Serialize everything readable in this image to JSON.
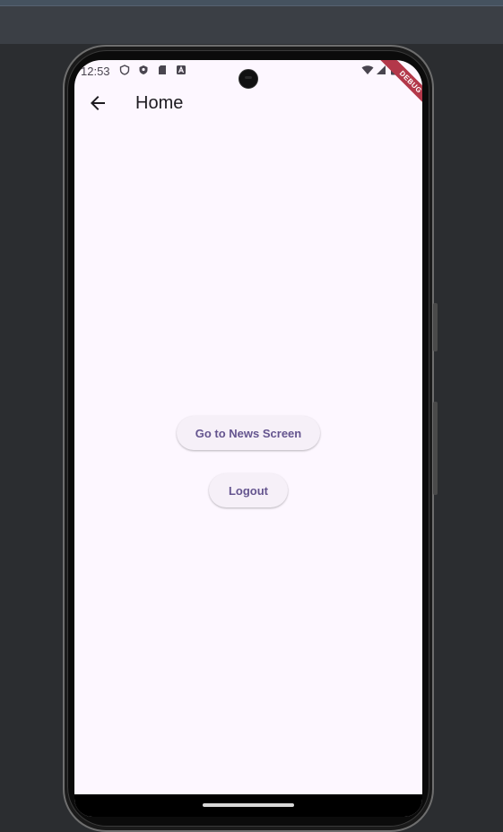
{
  "status_bar": {
    "time": "12:53"
  },
  "app_bar": {
    "title": "Home"
  },
  "buttons": {
    "news": "Go to News Screen",
    "logout": "Logout"
  },
  "debug_banner": "DEBUG",
  "colors": {
    "background": "#fdf7ff",
    "button_text": "#65558f",
    "button_bg": "#f6f0f8",
    "debug": "#b3384a"
  }
}
